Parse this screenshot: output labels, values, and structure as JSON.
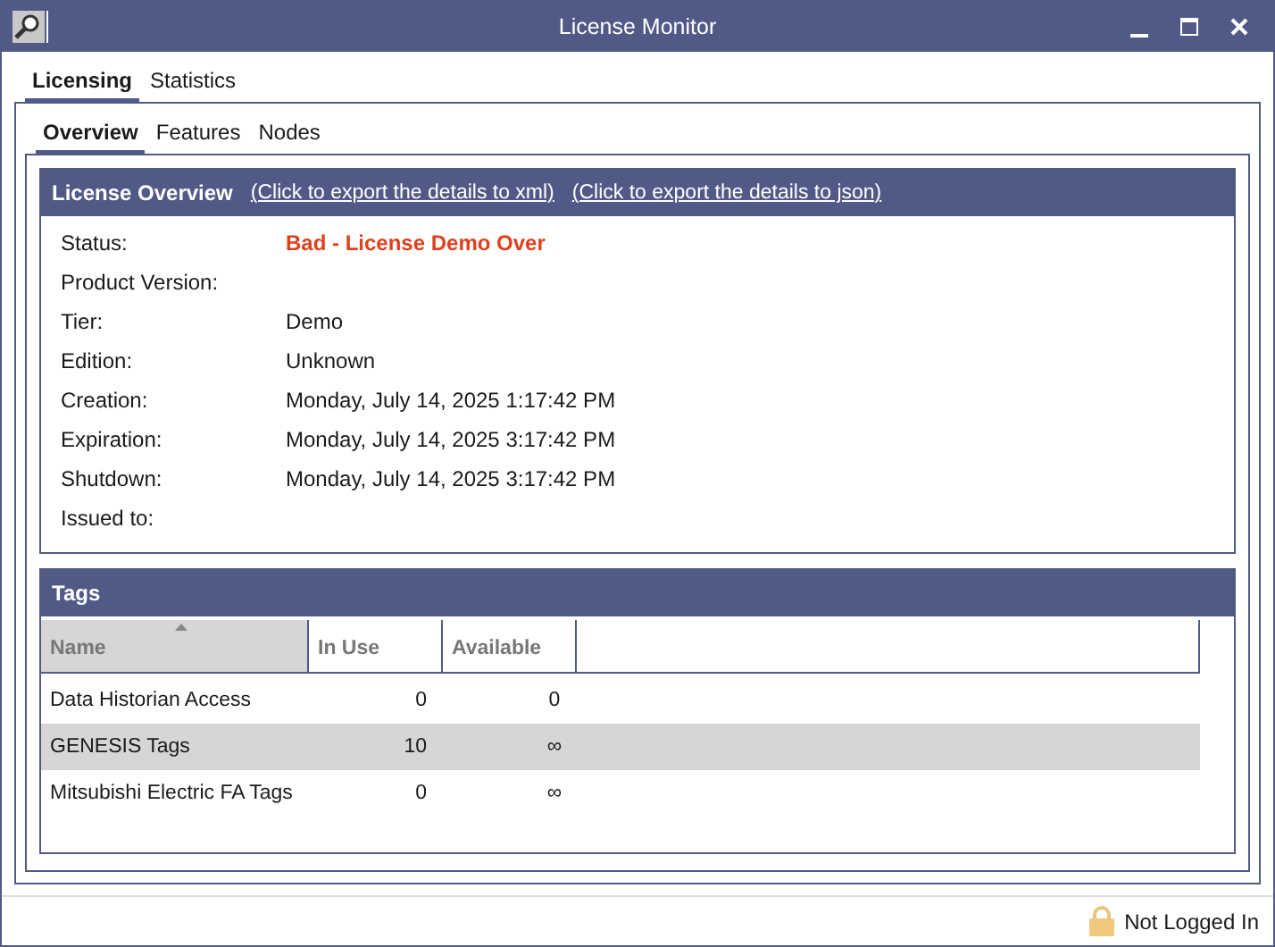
{
  "window": {
    "title": "License Monitor"
  },
  "tabs": [
    {
      "label": "Licensing",
      "selected": true
    },
    {
      "label": "Statistics",
      "selected": false
    }
  ],
  "subtabs": [
    {
      "label": "Overview",
      "selected": true
    },
    {
      "label": "Features",
      "selected": false
    },
    {
      "label": "Nodes",
      "selected": false
    }
  ],
  "overview": {
    "title": "License Overview",
    "links": [
      "(Click to export the details to xml)",
      "(Click to export the details to json)"
    ],
    "fields": [
      {
        "label": "Status:",
        "value": "Bad - License Demo Over",
        "kind": "alert"
      },
      {
        "label": "Product Version:",
        "kind": "plain"
      },
      {
        "label": "Tier:",
        "value": "Demo",
        "kind": "plain"
      },
      {
        "label": "Edition:",
        "value": "Unknown",
        "kind": "plain"
      },
      {
        "label": "Creation:",
        "value": "Monday, July 14, 2025 1:17:42 PM",
        "kind": "plain"
      },
      {
        "label": "Expiration:",
        "value": "Monday, July 14, 2025 3:17:42 PM",
        "kind": "plain"
      },
      {
        "label": "Shutdown:",
        "value": "Monday, July 14, 2025 3:17:42 PM",
        "kind": "plain"
      },
      {
        "label": "Issued to:",
        "kind": "plain"
      }
    ]
  },
  "tags": {
    "title": "Tags",
    "columns": [
      {
        "label": "Name",
        "sorted": true
      },
      {
        "label": "In Use",
        "sorted": false
      },
      {
        "label": "Available",
        "sorted": false
      }
    ],
    "rows": [
      {
        "name": "Data Historian Access",
        "in_use": "0",
        "available": "0",
        "selected": false
      },
      {
        "name": "GENESIS Tags",
        "in_use": "10",
        "available": "∞",
        "selected": true
      },
      {
        "name": "Mitsubishi Electric FA Tags",
        "in_use": "0",
        "available": "∞",
        "selected": false
      }
    ]
  },
  "status_bar": {
    "text": "Not Logged In"
  }
}
